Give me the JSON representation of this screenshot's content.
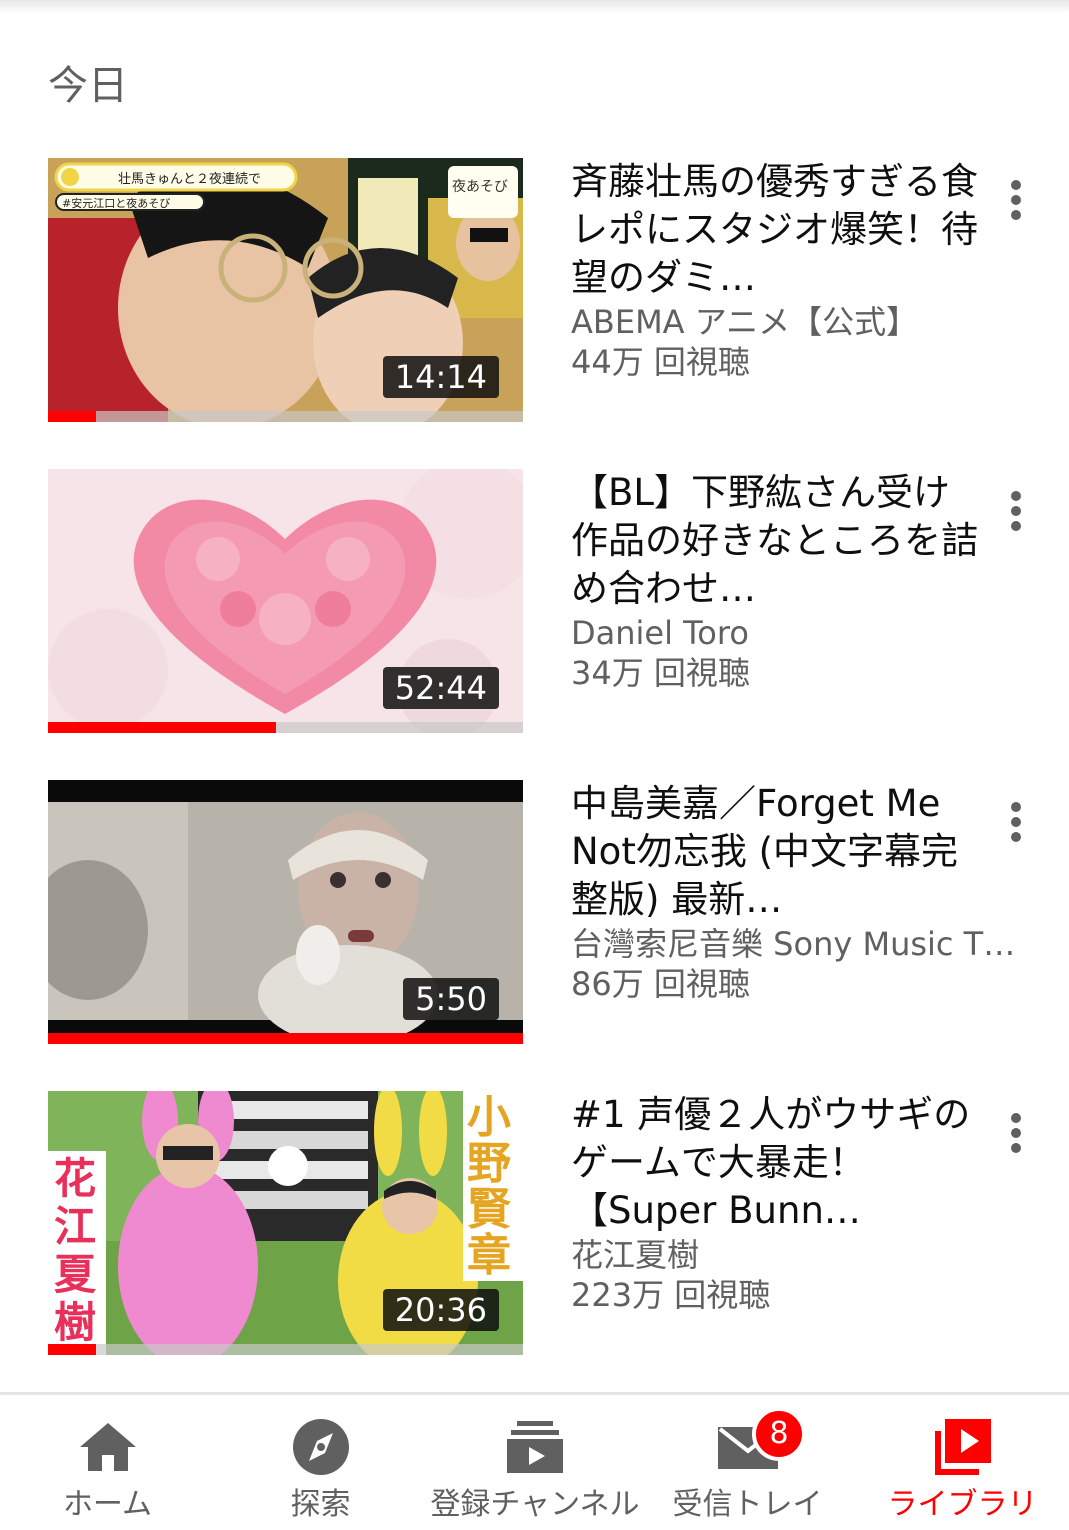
{
  "section": {
    "title": "今日"
  },
  "videos": [
    {
      "title": "斉藤壮馬の優秀すぎる食レポにスタジオ爆笑！待望のダミ…",
      "channel": "ABEMA アニメ【公式】",
      "views": "44万 回視聴",
      "duration": "14:14",
      "progress": 0.1,
      "thumb_caption_1": "壮馬きゅんと２夜連続で",
      "thumb_caption_2": "#安元江口と夜あそび",
      "thumb_logo": "夜あそび"
    },
    {
      "title": "【BL】下野紘さん受け作品の好きなところを詰め合わせ…",
      "channel": "Daniel Toro",
      "views": "34万 回視聴",
      "duration": "52:44",
      "progress": 0.48
    },
    {
      "title": "中島美嘉／Forget Me Not勿忘我 (中文字幕完整版) 最新…",
      "channel": "台灣索尼音樂 Sony Music T…",
      "views": "86万 回視聴",
      "duration": "5:50",
      "progress": 1.0
    },
    {
      "title": "#1 声優２人がウサギのゲームで大暴走！【Super Bunn…",
      "channel": "花江夏樹",
      "views": "223万 回視聴",
      "duration": "20:36",
      "progress": 0.1,
      "thumb_name_left": "花江夏樹",
      "thumb_name_right": "小野賢章"
    }
  ],
  "bottom_nav": [
    {
      "label": "ホーム",
      "icon": "home-icon"
    },
    {
      "label": "探索",
      "icon": "compass-icon"
    },
    {
      "label": "登録チャンネル",
      "icon": "subscriptions-icon"
    },
    {
      "label": "受信トレイ",
      "icon": "inbox-icon",
      "badge": "8"
    },
    {
      "label": "ライブラリ",
      "icon": "library-icon",
      "active": true
    }
  ],
  "colors": {
    "accent": "#ff0000",
    "text": "#0f0f0f",
    "secondary": "#606060"
  }
}
